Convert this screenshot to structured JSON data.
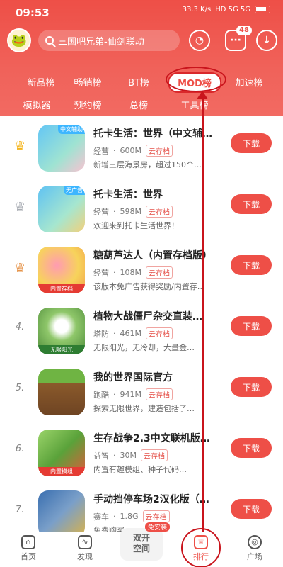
{
  "status_bar": {
    "time": "09:53",
    "net_speed": "33.3 K/s",
    "network": "HD 5G 5G",
    "battery": "battery"
  },
  "header": {
    "avatar_icon": "avatar-frog",
    "search_placeholder": "三国吧兄弟-仙剑联动",
    "badge_count": "48"
  },
  "tabs": {
    "row1": [
      "新品榜",
      "畅销榜",
      "BT榜",
      "MOD榜",
      "加速榜"
    ],
    "row2": [
      "模拟器",
      "预约榜",
      "总榜",
      "工具榜"
    ],
    "active": "MOD榜"
  },
  "apps": [
    {
      "rank": "",
      "crown": "gold",
      "title": "托卡生活：世界（中文辅…",
      "category": "经营",
      "size": "600M",
      "save": "云存档",
      "desc": "新增三层海景房，超过150个…",
      "download": "下载",
      "tag_top": "中文辅助",
      "tag_bottom": ""
    },
    {
      "rank": "",
      "crown": "silver",
      "title": "托卡生活：世界",
      "category": "经营",
      "size": "598M",
      "save": "云存档",
      "desc": "欢迎来到托卡生活世界！",
      "download": "下载",
      "tag_top": "无广告",
      "tag_bottom": ""
    },
    {
      "rank": "",
      "crown": "bronze",
      "title": "糖葫芦达人（内置存档版）",
      "category": "经营",
      "size": "108M",
      "save": "云存档",
      "desc": "该版本免广告获得奖励/内置存…",
      "download": "下载",
      "tag_top": "",
      "tag_bottom": "内置存档"
    },
    {
      "rank": "4.",
      "crown": "",
      "title": "植物大战僵尸杂交直装…",
      "category": "塔防",
      "size": "461M",
      "save": "云存档",
      "desc": "无限阳光，无冷却，大量金…",
      "download": "下载",
      "tag_top": "",
      "tag_bottom": "无限阳光"
    },
    {
      "rank": "5.",
      "crown": "",
      "title": "我的世界国际官方",
      "category": "跑酷",
      "size": "941M",
      "save": "云存档",
      "desc": "探索无限世界，建造包括了…",
      "download": "下载",
      "tag_top": "",
      "tag_bottom": ""
    },
    {
      "rank": "6.",
      "crown": "",
      "title": "生存战争2.3中文联机版…",
      "category": "益智",
      "size": "30M",
      "save": "云存档",
      "desc": "内置有趣模组、种子代码…",
      "download": "下载",
      "tag_top": "",
      "tag_bottom": "内置模组"
    },
    {
      "rank": "7.",
      "crown": "",
      "title": "手动挡停车场2汉化版（…",
      "category": "赛车",
      "size": "1.8G",
      "save": "云存档",
      "desc": "免费购买…",
      "download": "下载",
      "tag_top": "",
      "tag_bottom": ""
    }
  ],
  "bottom_nav": {
    "home": "首页",
    "discover": "发现",
    "center_line1": "双开",
    "center_line2": "空间",
    "center_tag": "免安装",
    "rank": "排行",
    "square": "广场"
  },
  "colors": {
    "brand": "#ee4f47",
    "annotation": "#c9141c"
  }
}
